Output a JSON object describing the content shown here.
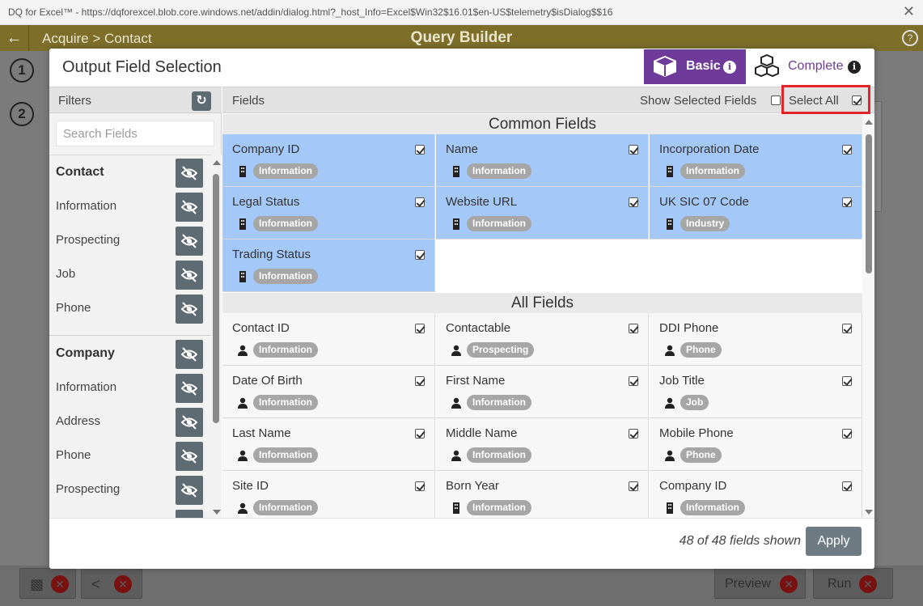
{
  "window": {
    "title": "DQ for Excel™ - https://dqforexcel.blob.core.windows.net/addin/dialog.html?_host_Info=Excel$Win32$16.01$en-US$telemetry$isDialog$$16",
    "close_glyph": "✕"
  },
  "app": {
    "back_glyph": "←",
    "breadcrumb": "Acquire  >  Contact",
    "title": "Query Builder",
    "help_glyph": "?",
    "steps": [
      "1",
      "2"
    ],
    "bottom_buttons": {
      "preview": "Preview",
      "run": "Run"
    }
  },
  "modal": {
    "title": "Output Field Selection",
    "modes": [
      {
        "label": "Basic",
        "active": true,
        "icon": "cube-icon"
      },
      {
        "label": "Complete",
        "active": false,
        "icon": "cubes-icon"
      }
    ],
    "accent_color": "#6f3b9a",
    "filters": {
      "header": "Filters",
      "search_placeholder": "Search Fields",
      "items": [
        {
          "label": "Contact",
          "group": true
        },
        {
          "label": "Information",
          "group": false
        },
        {
          "label": "Prospecting",
          "group": false
        },
        {
          "label": "Job",
          "group": false
        },
        {
          "label": "Phone",
          "group": false
        },
        {
          "label": "Company",
          "group": true
        },
        {
          "label": "Information",
          "group": false
        },
        {
          "label": "Address",
          "group": false
        },
        {
          "label": "Phone",
          "group": false
        },
        {
          "label": "Prospecting",
          "group": false
        }
      ]
    },
    "fields": {
      "header": "Fields",
      "show_selected_label": "Show Selected Fields",
      "show_selected_checked": false,
      "select_all_label": "Select All",
      "select_all_checked": true,
      "sections": [
        {
          "title": "Common Fields",
          "cards": [
            {
              "name": "Company ID",
              "tag": "Information",
              "icon": "building-icon",
              "checked": true
            },
            {
              "name": "Name",
              "tag": "Information",
              "icon": "building-icon",
              "checked": true
            },
            {
              "name": "Incorporation Date",
              "tag": "Information",
              "icon": "building-icon",
              "checked": true
            },
            {
              "name": "Legal Status",
              "tag": "Information",
              "icon": "building-icon",
              "checked": true
            },
            {
              "name": "Website URL",
              "tag": "Information",
              "icon": "building-icon",
              "checked": true
            },
            {
              "name": "UK SIC 07 Code",
              "tag": "Industry",
              "icon": "building-icon",
              "checked": true
            },
            {
              "name": "Trading Status",
              "tag": "Information",
              "icon": "building-icon",
              "checked": true
            }
          ]
        },
        {
          "title": "All Fields",
          "cards": [
            {
              "name": "Contact ID",
              "tag": "Information",
              "icon": "person-icon",
              "checked": true
            },
            {
              "name": "Contactable",
              "tag": "Prospecting",
              "icon": "person-icon",
              "checked": true
            },
            {
              "name": "DDI Phone",
              "tag": "Phone",
              "icon": "person-icon",
              "checked": true
            },
            {
              "name": "Date Of Birth",
              "tag": "Information",
              "icon": "person-icon",
              "checked": true
            },
            {
              "name": "First Name",
              "tag": "Information",
              "icon": "person-icon",
              "checked": true
            },
            {
              "name": "Job Title",
              "tag": "Job",
              "icon": "person-icon",
              "checked": true
            },
            {
              "name": "Last Name",
              "tag": "Information",
              "icon": "person-icon",
              "checked": true
            },
            {
              "name": "Middle Name",
              "tag": "Information",
              "icon": "person-icon",
              "checked": true
            },
            {
              "name": "Mobile Phone",
              "tag": "Phone",
              "icon": "person-icon",
              "checked": true
            },
            {
              "name": "Site ID",
              "tag": "Information",
              "icon": "person-icon",
              "checked": true
            },
            {
              "name": "Born Year",
              "tag": "Information",
              "icon": "building-icon",
              "checked": true
            },
            {
              "name": "Company ID",
              "tag": "Information",
              "icon": "building-icon",
              "checked": true
            }
          ]
        }
      ]
    },
    "footer": {
      "count_text": "48 of 48 fields shown",
      "apply_label": "Apply"
    },
    "selected_color": "#a4c8f8"
  }
}
